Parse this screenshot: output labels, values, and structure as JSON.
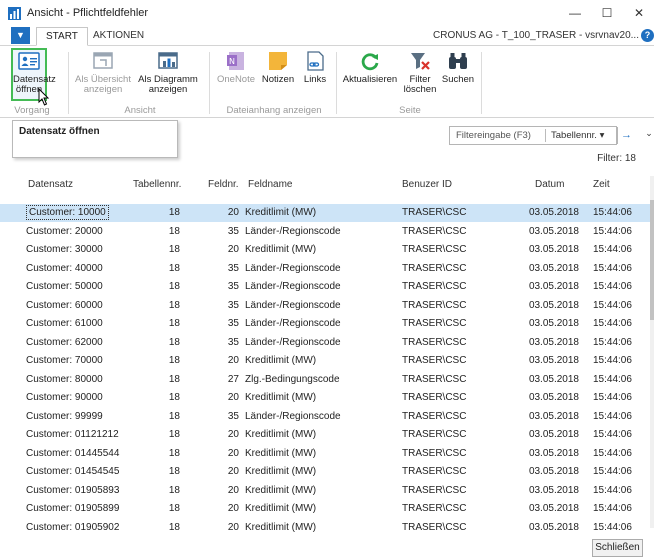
{
  "window": {
    "title": "Ansicht - Pflichtfeldfehler",
    "minimize": "—",
    "maximize": "☐",
    "close": "✕"
  },
  "menubar": {
    "tabs": [
      "START",
      "AKTIONEN"
    ],
    "company": "CRONUS AG - T_100_TRASER - vsrvnav20...",
    "help": "?"
  },
  "ribbon": {
    "buttons": [
      {
        "label": "Datensatz öffnen",
        "icon": "open-record-icon",
        "enabled": true
      },
      {
        "label": "Als Übersicht anzeigen",
        "icon": "list-view-icon",
        "enabled": false
      },
      {
        "label": "Als Diagramm anzeigen",
        "icon": "chart-view-icon",
        "enabled": true
      },
      {
        "label": "OneNote",
        "icon": "onenote-icon",
        "enabled": false
      },
      {
        "label": "Notizen",
        "icon": "notes-icon",
        "enabled": true
      },
      {
        "label": "Links",
        "icon": "links-icon",
        "enabled": true
      },
      {
        "label": "Aktualisieren",
        "icon": "refresh-icon",
        "enabled": true
      },
      {
        "label": "Filter löschen",
        "icon": "clear-filter-icon",
        "enabled": true
      },
      {
        "label": "Suchen",
        "icon": "binoculars-icon",
        "enabled": true
      }
    ],
    "groups": [
      "Vorgang",
      "Ansicht",
      "Dateianhang anzeigen",
      "Seite"
    ]
  },
  "tooltip": {
    "text": "Datensatz öffnen"
  },
  "filter": {
    "placeholder": "Filtereingabe (F3)",
    "field": "Tabellennr.",
    "dropdown_arrow": "▾",
    "go": "→",
    "expand": "⌄",
    "count": "Filter: 18"
  },
  "table": {
    "headers": [
      "Datensatz",
      "Tabellennr.",
      "Feldnr.",
      "Feldname",
      "Benuzer ID",
      "Datum",
      "Zeit"
    ],
    "rows": [
      [
        "Customer: 10000",
        "18",
        "20",
        "Kreditlimit (MW)",
        "TRASER\\CSC",
        "03.05.2018",
        "15:44:06"
      ],
      [
        "Customer: 20000",
        "18",
        "35",
        "Länder-/Regionscode",
        "TRASER\\CSC",
        "03.05.2018",
        "15:44:06"
      ],
      [
        "Customer: 30000",
        "18",
        "20",
        "Kreditlimit (MW)",
        "TRASER\\CSC",
        "03.05.2018",
        "15:44:06"
      ],
      [
        "Customer: 40000",
        "18",
        "35",
        "Länder-/Regionscode",
        "TRASER\\CSC",
        "03.05.2018",
        "15:44:06"
      ],
      [
        "Customer: 50000",
        "18",
        "35",
        "Länder-/Regionscode",
        "TRASER\\CSC",
        "03.05.2018",
        "15:44:06"
      ],
      [
        "Customer: 60000",
        "18",
        "35",
        "Länder-/Regionscode",
        "TRASER\\CSC",
        "03.05.2018",
        "15:44:06"
      ],
      [
        "Customer: 61000",
        "18",
        "35",
        "Länder-/Regionscode",
        "TRASER\\CSC",
        "03.05.2018",
        "15:44:06"
      ],
      [
        "Customer: 62000",
        "18",
        "35",
        "Länder-/Regionscode",
        "TRASER\\CSC",
        "03.05.2018",
        "15:44:06"
      ],
      [
        "Customer: 70000",
        "18",
        "20",
        "Kreditlimit (MW)",
        "TRASER\\CSC",
        "03.05.2018",
        "15:44:06"
      ],
      [
        "Customer: 80000",
        "18",
        "27",
        "Zlg.-Bedingungscode",
        "TRASER\\CSC",
        "03.05.2018",
        "15:44:06"
      ],
      [
        "Customer: 90000",
        "18",
        "20",
        "Kreditlimit (MW)",
        "TRASER\\CSC",
        "03.05.2018",
        "15:44:06"
      ],
      [
        "Customer: 99999",
        "18",
        "35",
        "Länder-/Regionscode",
        "TRASER\\CSC",
        "03.05.2018",
        "15:44:06"
      ],
      [
        "Customer: 01121212",
        "18",
        "20",
        "Kreditlimit (MW)",
        "TRASER\\CSC",
        "03.05.2018",
        "15:44:06"
      ],
      [
        "Customer: 01445544",
        "18",
        "20",
        "Kreditlimit (MW)",
        "TRASER\\CSC",
        "03.05.2018",
        "15:44:06"
      ],
      [
        "Customer: 01454545",
        "18",
        "20",
        "Kreditlimit (MW)",
        "TRASER\\CSC",
        "03.05.2018",
        "15:44:06"
      ],
      [
        "Customer: 01905893",
        "18",
        "20",
        "Kreditlimit (MW)",
        "TRASER\\CSC",
        "03.05.2018",
        "15:44:06"
      ],
      [
        "Customer: 01905899",
        "18",
        "20",
        "Kreditlimit (MW)",
        "TRASER\\CSC",
        "03.05.2018",
        "15:44:06"
      ],
      [
        "Customer: 01905902",
        "18",
        "20",
        "Kreditlimit (MW)",
        "TRASER\\CSC",
        "03.05.2018",
        "15:44:06"
      ]
    ]
  },
  "footer": {
    "close_label": "Schließen"
  },
  "colors": {
    "accent": "#1f6fc0",
    "selection": "#cde4f7",
    "highlight_border": "#44bb55"
  }
}
